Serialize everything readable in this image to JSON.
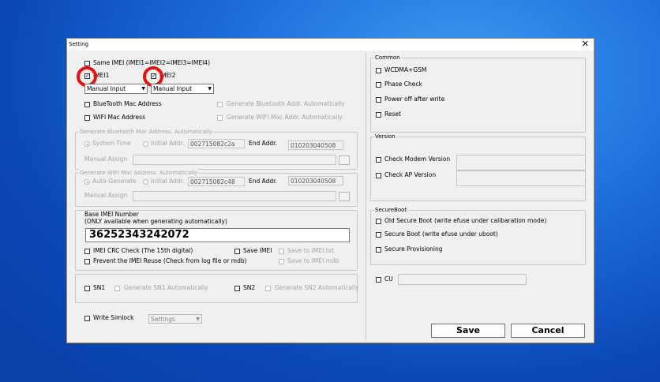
{
  "window": {
    "title": "Setting",
    "close_symbol": "✕"
  },
  "imei": {
    "same_imei_label": "Same IMEI (IMEI1=IMEI2=IMEI3=IMEI4)",
    "imei1_label": "IMEI1",
    "imei2_label": "IMEI2",
    "imei1_mode": "Manual Input",
    "imei2_mode": "Manual Input",
    "check_mark": "✓"
  },
  "bt": {
    "bt_mac_label": "BlueTooth Mac Address",
    "gen_bt_auto_label": "Generate Bluetooth Addr. Automatically",
    "wifi_mac_label": "WIFI Mac Address",
    "gen_wifi_auto_label": "Generate WIFI Mac Addr. Automatically",
    "bt_group_legend": "Generate Bluetooth Mac Address. Automatically",
    "system_time_label": "System Time",
    "initial_addr_label": "Initial Addr.",
    "bt_initial_addr": "002715082c2a",
    "end_addr_label": "End Addr.",
    "bt_end_addr": "010203040508",
    "manual_assign_label": "Manual Assign",
    "wifi_group_legend": "Generate WIFI Mac Address. Automatically",
    "auto_generate_label": "Auto-Generate",
    "wifi_initial_addr": "002715082c48",
    "wifi_end_addr": "010203040508"
  },
  "base_imei": {
    "title": "Base IMEI Number",
    "subtitle": "(ONLY available when generating automatically)",
    "value": "36252343242072",
    "crc_label": "IMEI CRC Check (The 15th digital)",
    "save_imei_label": "Save IMEI",
    "save_txt_label": "Save to IMEI.txt",
    "prevent_reuse_label": "Prevent the IMEI Reuse (Check from log file or mdb)",
    "save_mdb_label": "Save to IMEI.mdb"
  },
  "sn": {
    "sn1_label": "SN1",
    "gen_sn1_label": "Generate SN1 Automatically",
    "sn2_label": "SN2",
    "gen_sn2_label": "Generate SN2 Automatically"
  },
  "simlock": {
    "label": "Write Simlock",
    "value": "Settings"
  },
  "common": {
    "legend": "Common",
    "wcdma_gsm": "WCDMA+GSM",
    "phase_check": "Phase Check",
    "power_off": "Power off after write",
    "reset": "Reset"
  },
  "version": {
    "legend": "Version",
    "check_modem": "Check Modem Version",
    "check_ap": "Check AP Version"
  },
  "secureboot": {
    "legend": "SecureBoot",
    "old_secure": "Old Secure Boot (write efuse under calibaration  mode)",
    "secure_boot": "Secure Boot (write efuse under uboot)",
    "secure_provisioning": "Secure Provisioning"
  },
  "cu": {
    "label": "CU"
  },
  "buttons": {
    "save": "Save",
    "cancel": "Cancel"
  },
  "colors": {
    "highlight_ring": "#e81010",
    "desktop": "#1e6fdc"
  }
}
